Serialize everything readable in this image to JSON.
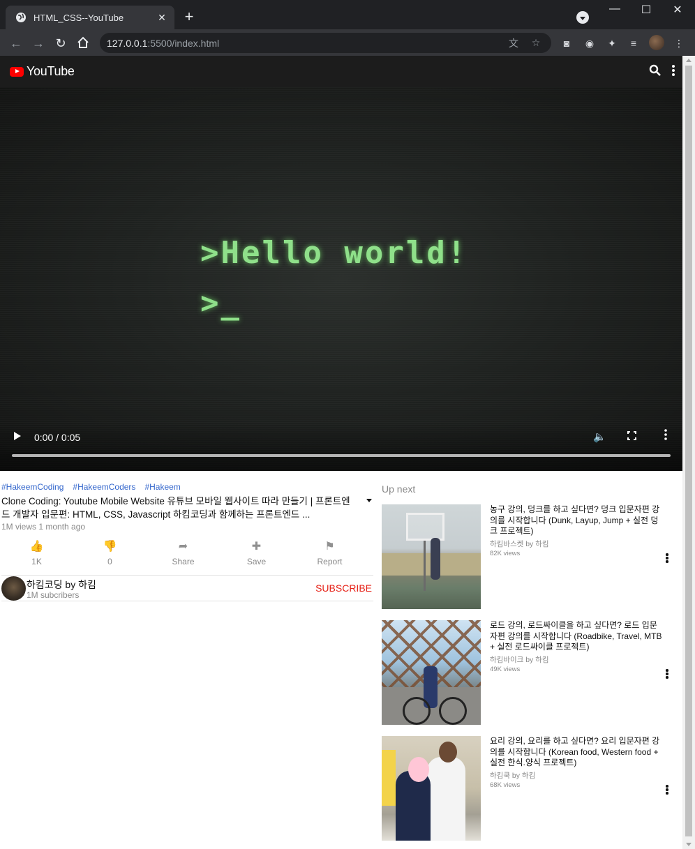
{
  "browser": {
    "tab_title": "HTML_CSS--YouTube",
    "tab_close": "✕",
    "new_tab": "+",
    "url_host": "127.0.0.1",
    "url_rest": ":5500/index.html",
    "win_min": "—",
    "win_max": "☐",
    "win_close": "✕"
  },
  "header": {
    "brand": "YouTube"
  },
  "video": {
    "screen_line1": ">Hello world!",
    "screen_line2": ">_",
    "time": "0:00 / 0:05"
  },
  "info": {
    "tags": [
      "#HakeemCoding",
      "#HakeemCoders",
      "#Hakeem"
    ],
    "title": "Clone Coding: Youtube Mobile Website 유튜브 모바일 웹사이트 따라 만들기 | 프론트엔드 개발자 입문편: HTML, CSS, Javascript 하킴코딩과 함께하는 프론트엔드 ...",
    "meta": "1M views 1 month ago",
    "actions": [
      {
        "icon": "👍",
        "label": "1K"
      },
      {
        "icon": "👎",
        "label": "0"
      },
      {
        "icon": "➦",
        "label": "Share"
      },
      {
        "icon": "✚",
        "label": "Save"
      },
      {
        "icon": "⚑",
        "label": "Report"
      }
    ],
    "channel_name": "하킴코딩 by 하킴",
    "channel_subs": "1M subcribers",
    "subscribe_label": "SUBSCRIBE"
  },
  "upnext": {
    "heading": "Up next",
    "items": [
      {
        "title": "농구 강의, 덩크를 하고 싶다면? 덩크 입문자편 강의를 시작합니다 (Dunk, Layup, Jump + 실전 덩크 프로젝트)",
        "channel": "하킴바스켓 by 하킴",
        "views": "82K views"
      },
      {
        "title": "로드 강의, 로드싸이클을 하고 싶다면? 로드 입문자편 강의를 시작합니다 (Roadbike, Travel, MTB + 실전 로드싸이클 프로젝트)",
        "channel": "하킴바이크 by 하킴",
        "views": "49K views"
      },
      {
        "title": "요리 강의, 요리를 하고 싶다면? 요리 입문자편 강의를 시작합니다 (Korean food, Western food + 실전 한식.양식 프로젝트)",
        "channel": "하킴쿡 by 하킴",
        "views": "68K views"
      }
    ]
  },
  "colors": {
    "brand_red": "#ff0000",
    "subscribe_red": "#e62117",
    "tag_blue": "#3366cc",
    "crt_green": "#8fe08a"
  }
}
